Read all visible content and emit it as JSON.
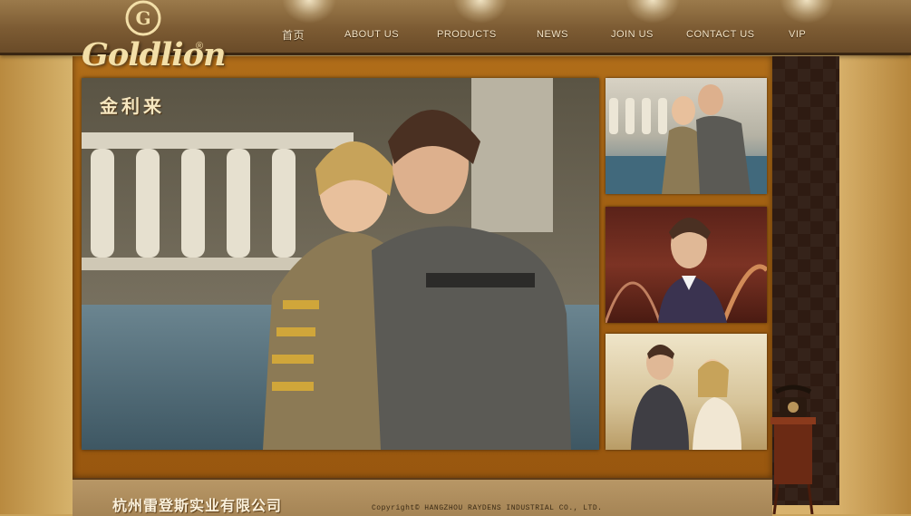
{
  "nav": {
    "items": [
      {
        "label": "首页",
        "key": "home"
      },
      {
        "label": "ABOUT US",
        "key": "about"
      },
      {
        "label": "PRODUCTS",
        "key": "products"
      },
      {
        "label": "NEWS",
        "key": "news"
      },
      {
        "label": "JOIN US",
        "key": "join"
      },
      {
        "label": "CONTACT US",
        "key": "contact"
      },
      {
        "label": "VIP",
        "key": "vip"
      }
    ]
  },
  "logo": {
    "wordmark": "Goldlion",
    "registered": "®",
    "chinese": "金利来",
    "emblem_letter": "G"
  },
  "footer": {
    "company": "杭州雷登斯实业有限公司",
    "copyright": "Copyright©  HANGZHOU RAYDENS INDUSTRIAL CO., LTD."
  },
  "colors": {
    "brand_gold": "#f3dfa8",
    "frame_amber": "#a05f12",
    "nav_brown": "#7c5b33",
    "panel_dark": "#2e1b12"
  }
}
